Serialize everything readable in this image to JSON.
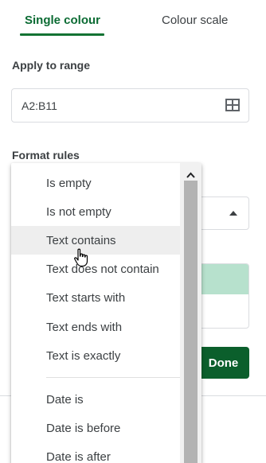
{
  "tabs": {
    "single": "Single colour",
    "scale": "Colour scale"
  },
  "apply_to_range": {
    "label": "Apply to range",
    "value": "A2:B11"
  },
  "format_rules": {
    "label": "Format rules"
  },
  "done_button": "Done",
  "menu": {
    "items": [
      {
        "label": "Is empty"
      },
      {
        "label": "Is not empty"
      },
      {
        "label": "Text contains",
        "hovered": true
      },
      {
        "label": "Text does not contain"
      },
      {
        "label": "Text starts with"
      },
      {
        "label": "Text ends with"
      },
      {
        "label": "Text is exactly"
      },
      {
        "label": "Date is"
      },
      {
        "label": "Date is before"
      },
      {
        "label": "Date is after"
      }
    ]
  },
  "colors": {
    "accent": "#137333",
    "done": "#0b5f2c",
    "preview_fill": "#b7e1cd"
  },
  "icons": [
    "grid-range-icon",
    "chevron-up-icon",
    "caret-up-icon",
    "hand-pointer-icon"
  ]
}
